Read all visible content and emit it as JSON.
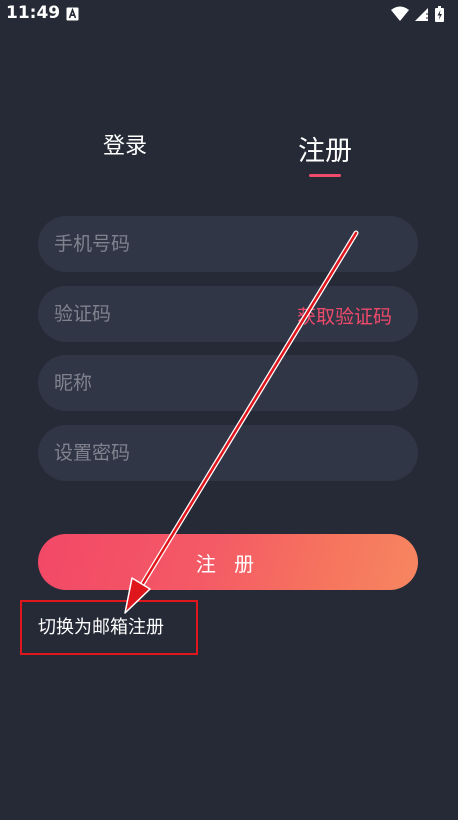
{
  "status_bar": {
    "time": "11:49",
    "notification_icon": "accessibility-a-icon",
    "icons": [
      "wifi-icon",
      "cellular-signal-icon",
      "battery-charging-icon"
    ]
  },
  "tabs": {
    "login_label": "登录",
    "register_label": "注册",
    "active": "register"
  },
  "form": {
    "phone_placeholder": "手机号码",
    "code_placeholder": "验证码",
    "get_code_label": "获取验证码",
    "nickname_placeholder": "昵称",
    "password_placeholder": "设置密码"
  },
  "submit_label": "注 册",
  "switch_link_label": "切换为邮箱注册",
  "colors": {
    "background": "#252a36",
    "field_background": "#313647",
    "accent": "#ef4a6a",
    "annotation_red": "#e0161d"
  }
}
